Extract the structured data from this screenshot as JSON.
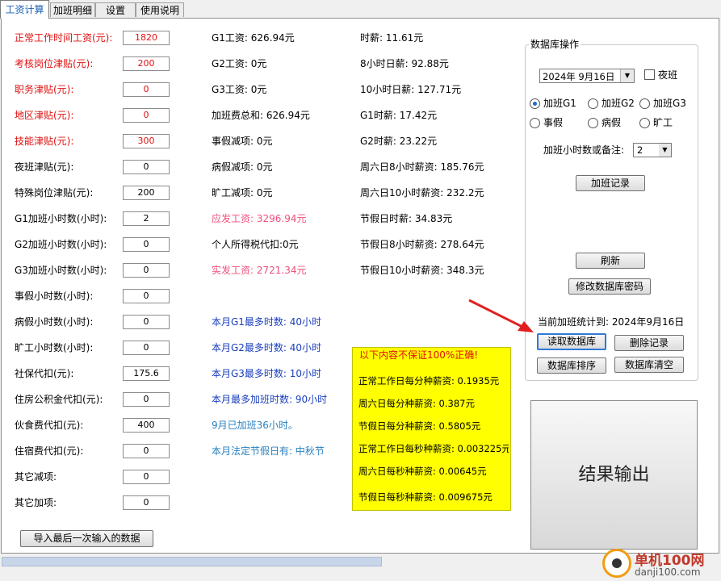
{
  "tabs": [
    "工资计算",
    "加班明细",
    "设置",
    "使用说明"
  ],
  "fields": [
    {
      "label": "正常工作时间工资(元):",
      "value": "1820"
    },
    {
      "label": "考核岗位津贴(元):",
      "value": "200"
    },
    {
      "label": "职务津贴(元):",
      "value": "0"
    },
    {
      "label": "地区津贴(元):",
      "value": "0"
    },
    {
      "label": "技能津贴(元):",
      "value": "300"
    },
    {
      "label": "夜班津贴(元):",
      "value": "0"
    },
    {
      "label": "特殊岗位津贴(元):",
      "value": "200"
    },
    {
      "label": "G1加班小时数(小时):",
      "value": "2"
    },
    {
      "label": "G2加班小时数(小时):",
      "value": "0"
    },
    {
      "label": "G3加班小时数(小时):",
      "value": "0"
    },
    {
      "label": "事假小时数(小时):",
      "value": "0"
    },
    {
      "label": "病假小时数(小时):",
      "value": "0"
    },
    {
      "label": "旷工小时数(小时):",
      "value": "0"
    },
    {
      "label": "社保代扣(元):",
      "value": "175.6"
    },
    {
      "label": "住房公积金代扣(元):",
      "value": "0"
    },
    {
      "label": "伙食费代扣(元):",
      "value": "400"
    },
    {
      "label": "住宿费代扣(元):",
      "value": "0"
    },
    {
      "label": "其它减项:",
      "value": "0"
    },
    {
      "label": "其它加项:",
      "value": "0"
    }
  ],
  "col2": [
    "G1工资: 626.94元",
    "G2工资: 0元",
    "G3工资: 0元",
    "加班费总和: 626.94元",
    "事假减项: 0元",
    "病假减项: 0元",
    "旷工减项: 0元",
    "应发工资: 3296.94元",
    "个人所得税代扣:0元",
    "实发工资: 2721.34元"
  ],
  "col2_blue": [
    "本月G1最多时数: 40小时",
    "本月G2最多时数: 40小时",
    "本月G3最多时数: 10小时",
    "本月最多加班时数: 90小时",
    "9月已加班36小时。",
    "本月法定节假日有: 中秋节"
  ],
  "col3": [
    "时薪: 11.61元",
    "8小时日薪: 92.88元",
    "10小时日薪: 127.71元",
    "G1时薪: 17.42元",
    "G2时薪: 23.22元",
    "周六日8小时薪资: 185.76元",
    "周六日10小时薪资: 232.2元",
    "节假日时薪: 34.83元",
    "节假日8小时薪资: 278.64元",
    "节假日10小时薪资: 348.3元"
  ],
  "notice": {
    "title": "以下内容不保证100%正确!",
    "lines": [
      "正常工作日每分种薪资: 0.1935元",
      "周六日每分种薪资: 0.387元",
      "节假日每分种薪资: 0.5805元",
      "正常工作日每秒种薪资: 0.003225元",
      "周六日每秒种薪资: 0.00645元",
      "节假日每秒种薪资: 0.009675元"
    ]
  },
  "db": {
    "title": "数据库操作",
    "date": "2024年 9月16日",
    "night_label": "夜班",
    "radios": [
      "加班G1",
      "加班G2",
      "加班G3",
      "事假",
      "病假",
      "旷工"
    ],
    "hours_label": "加班小时数或备注:",
    "hours_value": "2",
    "add_button": "加班记录",
    "refresh_button": "刷新",
    "change_pw_button": "修改数据库密码",
    "stat": "当前加班统计到: 2024年9月16日",
    "read_button": "读取数据库",
    "delete_button": "删除记录",
    "sort_button": "数据库排序",
    "clear_button": "数据库清空"
  },
  "result_label": "结果输出",
  "import_button": "导入最后一次输入的数据",
  "watermark": {
    "name": "单机100网",
    "url": "danji100.com"
  }
}
